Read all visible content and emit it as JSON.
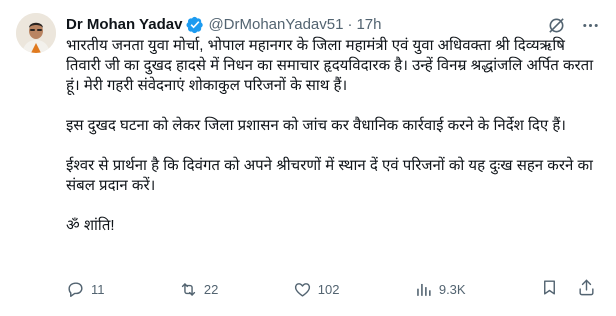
{
  "tweet": {
    "author_name": "Dr Mohan Yadav",
    "handle": "@DrMohanYadav51",
    "separator": "·",
    "time": "17h",
    "paragraphs": [
      "भारतीय जनता युवा मोर्चा, भोपाल महानगर के जिला महामंत्री एवं युवा अधिवक्ता श्री दिव्यऋषि तिवारी जी का दुखद हादसे में निधन का समाचार हृदयविदारक है। उन्हें विनम्र श्रद्धांजलि अर्पित करता हूं। मेरी गहरी संवेदनाएं शोकाकुल परिजनों के साथ हैं।",
      "इस दुखद घटना को लेकर जिला प्रशासन को जांच कर वैधानिक कार्रवाई करने के निर्देश दिए हैं।",
      "ईश्वर से प्रार्थना है कि दिवंगत को अपने श्रीचरणों में स्थान दें एवं परिजनों को यह दुःख सहन करने का संबल प्रदान करें।",
      "ॐ शांति!"
    ]
  },
  "actions": {
    "replies": "11",
    "reposts": "22",
    "likes": "102",
    "views": "9.3K"
  },
  "colors": {
    "text": "#0f1419",
    "muted": "#536471",
    "verified": "#1d9bf0",
    "background": "#ffffff"
  },
  "icons": [
    "verified-badge-icon",
    "grok-icon",
    "more-icon",
    "reply-icon",
    "repost-icon",
    "like-icon",
    "views-icon",
    "bookmark-icon",
    "share-icon"
  ]
}
